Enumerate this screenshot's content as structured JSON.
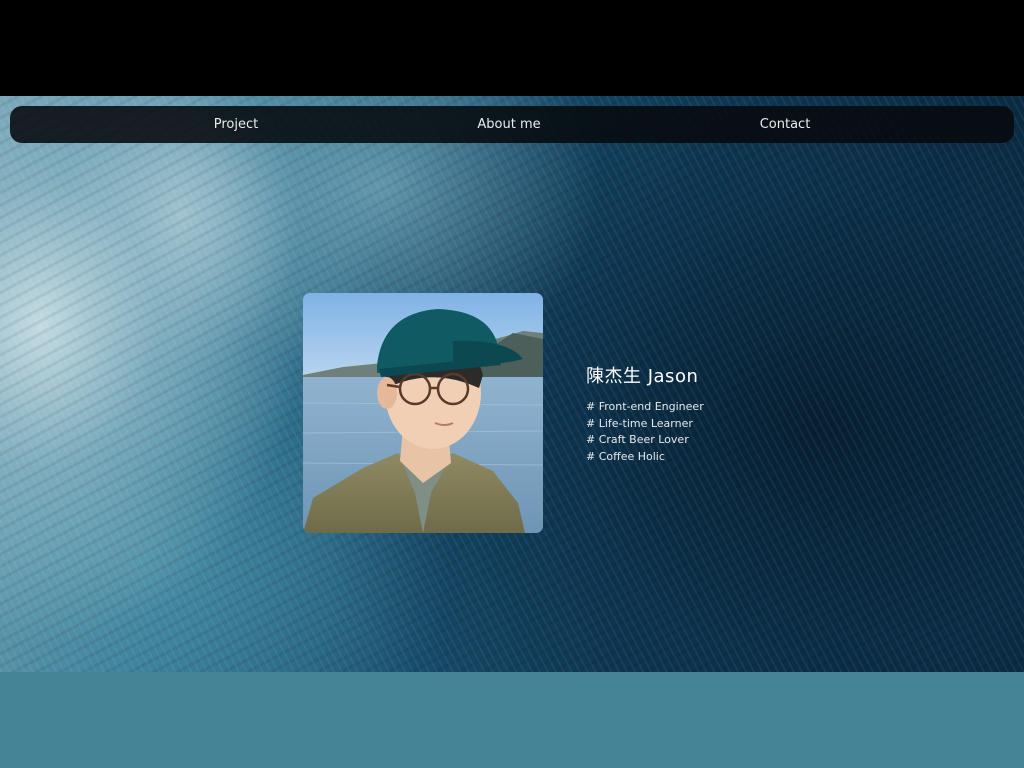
{
  "nav": {
    "items": [
      {
        "label": "Project"
      },
      {
        "label": "About me"
      },
      {
        "label": "Contact"
      }
    ]
  },
  "profile": {
    "name": "陳杰生 Jason",
    "tags": [
      "# Front-end Engineer",
      "# Life-time Learner",
      "# Craft Beer Lover",
      "# Coffee Holic"
    ]
  },
  "colors": {
    "top_bar": "#000000",
    "navbar_bg": "#060a0e",
    "ocean_dark": "#0b2c45",
    "ocean_light": "#6f9fb2",
    "bottom_band": "#458396"
  },
  "icons": {
    "photo": "portrait-photo"
  }
}
